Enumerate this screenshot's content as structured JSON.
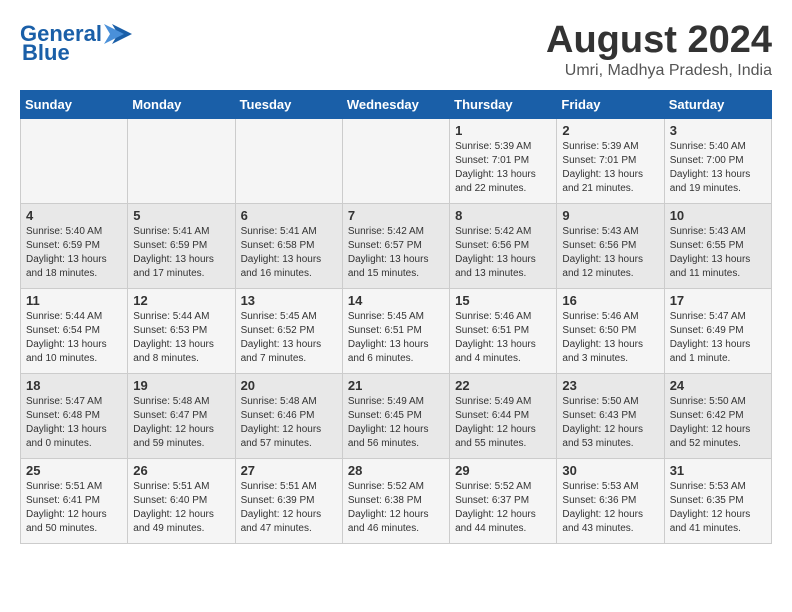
{
  "header": {
    "logo_line1": "General",
    "logo_line2": "Blue",
    "main_title": "August 2024",
    "subtitle": "Umri, Madhya Pradesh, India"
  },
  "days_of_week": [
    "Sunday",
    "Monday",
    "Tuesday",
    "Wednesday",
    "Thursday",
    "Friday",
    "Saturday"
  ],
  "weeks": [
    [
      {
        "day": "",
        "info": ""
      },
      {
        "day": "",
        "info": ""
      },
      {
        "day": "",
        "info": ""
      },
      {
        "day": "",
        "info": ""
      },
      {
        "day": "1",
        "info": "Sunrise: 5:39 AM\nSunset: 7:01 PM\nDaylight: 13 hours\nand 22 minutes."
      },
      {
        "day": "2",
        "info": "Sunrise: 5:39 AM\nSunset: 7:01 PM\nDaylight: 13 hours\nand 21 minutes."
      },
      {
        "day": "3",
        "info": "Sunrise: 5:40 AM\nSunset: 7:00 PM\nDaylight: 13 hours\nand 19 minutes."
      }
    ],
    [
      {
        "day": "4",
        "info": "Sunrise: 5:40 AM\nSunset: 6:59 PM\nDaylight: 13 hours\nand 18 minutes."
      },
      {
        "day": "5",
        "info": "Sunrise: 5:41 AM\nSunset: 6:59 PM\nDaylight: 13 hours\nand 17 minutes."
      },
      {
        "day": "6",
        "info": "Sunrise: 5:41 AM\nSunset: 6:58 PM\nDaylight: 13 hours\nand 16 minutes."
      },
      {
        "day": "7",
        "info": "Sunrise: 5:42 AM\nSunset: 6:57 PM\nDaylight: 13 hours\nand 15 minutes."
      },
      {
        "day": "8",
        "info": "Sunrise: 5:42 AM\nSunset: 6:56 PM\nDaylight: 13 hours\nand 13 minutes."
      },
      {
        "day": "9",
        "info": "Sunrise: 5:43 AM\nSunset: 6:56 PM\nDaylight: 13 hours\nand 12 minutes."
      },
      {
        "day": "10",
        "info": "Sunrise: 5:43 AM\nSunset: 6:55 PM\nDaylight: 13 hours\nand 11 minutes."
      }
    ],
    [
      {
        "day": "11",
        "info": "Sunrise: 5:44 AM\nSunset: 6:54 PM\nDaylight: 13 hours\nand 10 minutes."
      },
      {
        "day": "12",
        "info": "Sunrise: 5:44 AM\nSunset: 6:53 PM\nDaylight: 13 hours\nand 8 minutes."
      },
      {
        "day": "13",
        "info": "Sunrise: 5:45 AM\nSunset: 6:52 PM\nDaylight: 13 hours\nand 7 minutes."
      },
      {
        "day": "14",
        "info": "Sunrise: 5:45 AM\nSunset: 6:51 PM\nDaylight: 13 hours\nand 6 minutes."
      },
      {
        "day": "15",
        "info": "Sunrise: 5:46 AM\nSunset: 6:51 PM\nDaylight: 13 hours\nand 4 minutes."
      },
      {
        "day": "16",
        "info": "Sunrise: 5:46 AM\nSunset: 6:50 PM\nDaylight: 13 hours\nand 3 minutes."
      },
      {
        "day": "17",
        "info": "Sunrise: 5:47 AM\nSunset: 6:49 PM\nDaylight: 13 hours\nand 1 minute."
      }
    ],
    [
      {
        "day": "18",
        "info": "Sunrise: 5:47 AM\nSunset: 6:48 PM\nDaylight: 13 hours\nand 0 minutes."
      },
      {
        "day": "19",
        "info": "Sunrise: 5:48 AM\nSunset: 6:47 PM\nDaylight: 12 hours\nand 59 minutes."
      },
      {
        "day": "20",
        "info": "Sunrise: 5:48 AM\nSunset: 6:46 PM\nDaylight: 12 hours\nand 57 minutes."
      },
      {
        "day": "21",
        "info": "Sunrise: 5:49 AM\nSunset: 6:45 PM\nDaylight: 12 hours\nand 56 minutes."
      },
      {
        "day": "22",
        "info": "Sunrise: 5:49 AM\nSunset: 6:44 PM\nDaylight: 12 hours\nand 55 minutes."
      },
      {
        "day": "23",
        "info": "Sunrise: 5:50 AM\nSunset: 6:43 PM\nDaylight: 12 hours\nand 53 minutes."
      },
      {
        "day": "24",
        "info": "Sunrise: 5:50 AM\nSunset: 6:42 PM\nDaylight: 12 hours\nand 52 minutes."
      }
    ],
    [
      {
        "day": "25",
        "info": "Sunrise: 5:51 AM\nSunset: 6:41 PM\nDaylight: 12 hours\nand 50 minutes."
      },
      {
        "day": "26",
        "info": "Sunrise: 5:51 AM\nSunset: 6:40 PM\nDaylight: 12 hours\nand 49 minutes."
      },
      {
        "day": "27",
        "info": "Sunrise: 5:51 AM\nSunset: 6:39 PM\nDaylight: 12 hours\nand 47 minutes."
      },
      {
        "day": "28",
        "info": "Sunrise: 5:52 AM\nSunset: 6:38 PM\nDaylight: 12 hours\nand 46 minutes."
      },
      {
        "day": "29",
        "info": "Sunrise: 5:52 AM\nSunset: 6:37 PM\nDaylight: 12 hours\nand 44 minutes."
      },
      {
        "day": "30",
        "info": "Sunrise: 5:53 AM\nSunset: 6:36 PM\nDaylight: 12 hours\nand 43 minutes."
      },
      {
        "day": "31",
        "info": "Sunrise: 5:53 AM\nSunset: 6:35 PM\nDaylight: 12 hours\nand 41 minutes."
      }
    ]
  ]
}
